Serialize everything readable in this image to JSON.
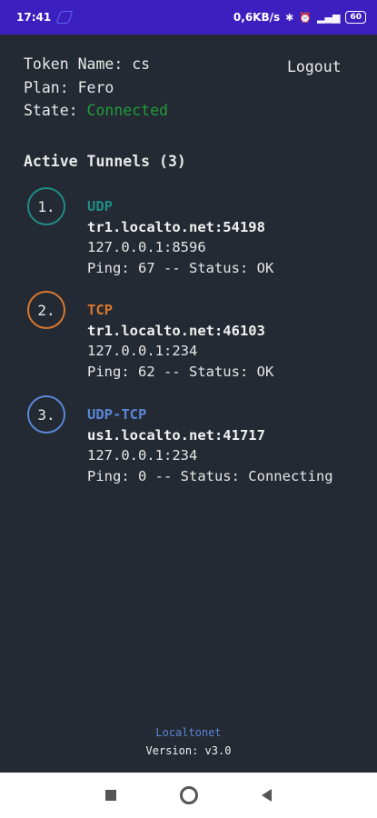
{
  "status_bar": {
    "time": "17:41",
    "network_speed": "0,6KB/s",
    "battery": "60",
    "icons": [
      "app-icon",
      "bluetooth-icon",
      "alarm-icon",
      "signal-icon",
      "battery-icon"
    ]
  },
  "account": {
    "token_line": "Token Name: cs",
    "plan_line": "Plan: Fero",
    "state_label": "State: ",
    "state_value": "Connected"
  },
  "logout_label": "Logout",
  "tunnels_title": "Active Tunnels (3)",
  "tunnels": [
    {
      "index": "1.",
      "protocol": "UDP",
      "remote": "tr1.localto.net:54198",
      "local": "127.0.0.1:8596",
      "status_line": "Ping: 67 -- Status: OK",
      "color": "#1e8c86"
    },
    {
      "index": "2.",
      "protocol": "TCP",
      "remote": "tr1.localto.net:46103",
      "local": "127.0.0.1:234",
      "status_line": "Ping: 62 -- Status: OK",
      "color": "#d9772e"
    },
    {
      "index": "3.",
      "protocol": "UDP-TCP",
      "remote": "us1.localto.net:41717",
      "local": "127.0.0.1:234",
      "status_line": "Ping: 0 -- Status: Connecting",
      "color": "#5a86d6"
    }
  ],
  "footer": {
    "brand": "Localtonet",
    "version": "Version: v3.0"
  },
  "colors": {
    "background": "#242a33",
    "status_bar": "#3b1fbf",
    "connected": "#1f9d3a"
  }
}
